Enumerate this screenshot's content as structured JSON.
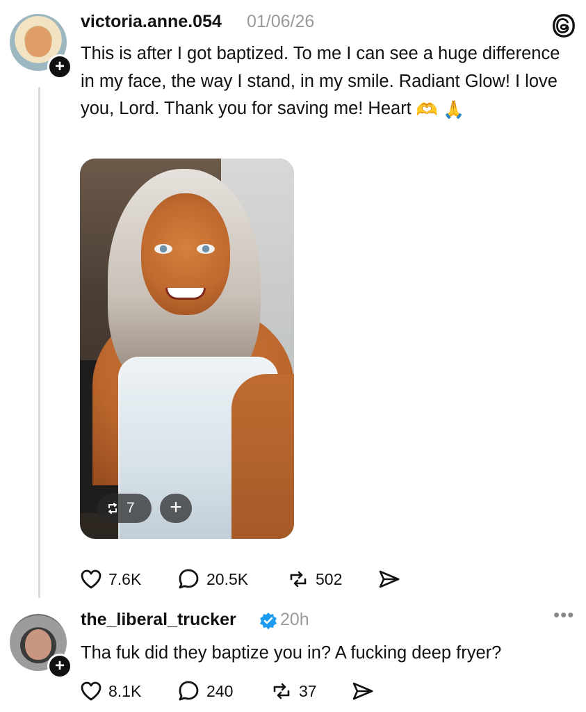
{
  "post": {
    "username": "victoria.anne.054",
    "date": "01/06/26",
    "text": "This is after I got baptized. To me I can see a huge difference in my face, the way I stand, in my smile. Radiant Glow! I love you, Lord. Thank you for saving me! Heart",
    "text_emojis": [
      "🫶",
      "🙏"
    ],
    "media": {
      "repost_count": "7",
      "plus_label": "+"
    },
    "actions": {
      "likes": "7.6K",
      "replies": "20.5K",
      "reposts": "502"
    }
  },
  "reply": {
    "username": "the_liberal_trucker",
    "time": "20h",
    "text": "Tha fuk did they baptize you in? A fucking deep fryer?",
    "actions": {
      "likes": "8.1K",
      "replies": "240",
      "reposts": "37"
    },
    "more_label": "•••"
  },
  "icons": {
    "threads_logo": "threads-icon",
    "like": "heart-icon",
    "reply": "comment-icon",
    "repost": "repost-icon",
    "share": "share-icon",
    "verified": "verified-icon",
    "follow": "plus-icon"
  },
  "colors": {
    "text": "#111111",
    "muted": "#9a9a9a",
    "verified_blue": "#1d9bf0",
    "thread_line": "#d9d9d9"
  }
}
